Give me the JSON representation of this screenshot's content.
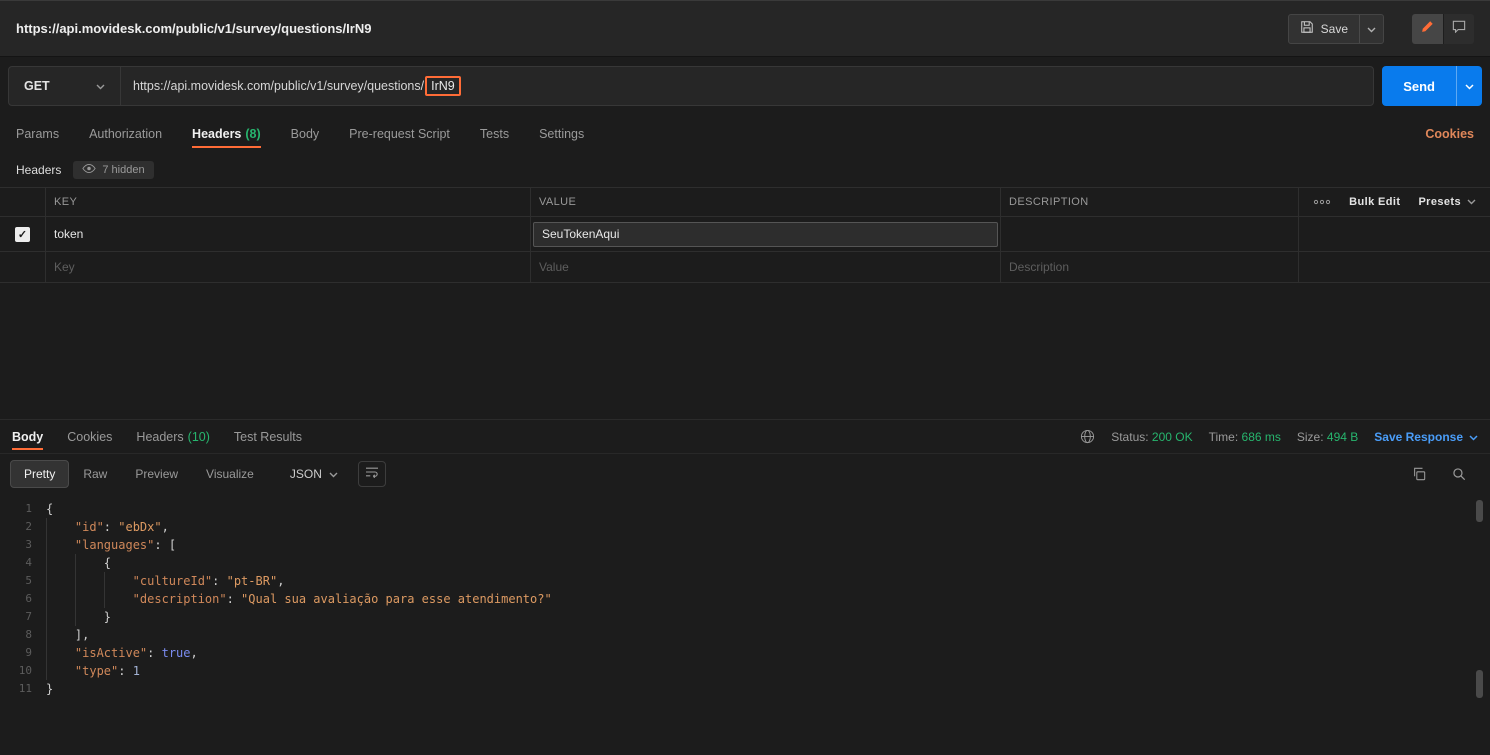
{
  "colors": {
    "accent_orange": "#ff6c37",
    "send_blue": "#097bed",
    "status_green": "#27b56e",
    "link_blue": "#4a9df8"
  },
  "topbar": {
    "request_title": "https://api.movidesk.com/public/v1/survey/questions/IrN9",
    "save_label": "Save"
  },
  "request": {
    "method": "GET",
    "url_prefix": "https://api.movidesk.com/public/v1/survey/questions/",
    "url_highlighted_segment": "IrN9",
    "send_label": "Send",
    "tabs": [
      {
        "label": "Params"
      },
      {
        "label": "Authorization"
      },
      {
        "label": "Headers",
        "count": "(8)",
        "active": true
      },
      {
        "label": "Body"
      },
      {
        "label": "Pre-request Script"
      },
      {
        "label": "Tests"
      },
      {
        "label": "Settings"
      }
    ],
    "cookies_link": "Cookies"
  },
  "headers_editor": {
    "title": "Headers",
    "hidden_badge": "7 hidden",
    "columns": {
      "key": "KEY",
      "value": "VALUE",
      "description": "DESCRIPTION"
    },
    "bulk_edit_label": "Bulk Edit",
    "presets_label": "Presets",
    "rows": [
      {
        "key": "token",
        "value": "SeuTokenAqui",
        "description": ""
      }
    ],
    "placeholders": {
      "key": "Key",
      "value": "Value",
      "description": "Description"
    }
  },
  "response": {
    "tabs": [
      {
        "label": "Body",
        "active": true
      },
      {
        "label": "Cookies"
      },
      {
        "label": "Headers",
        "count": "(10)"
      },
      {
        "label": "Test Results"
      }
    ],
    "meta": {
      "status_label": "Status:",
      "status_value": "200 OK",
      "time_label": "Time:",
      "time_value": "686 ms",
      "size_label": "Size:",
      "size_value": "494 B",
      "save_response_label": "Save Response"
    },
    "view_tabs": [
      {
        "label": "Pretty",
        "active": true
      },
      {
        "label": "Raw"
      },
      {
        "label": "Preview"
      },
      {
        "label": "Visualize"
      }
    ],
    "format_dropdown": "JSON",
    "code": {
      "lines": [
        {
          "n": 1,
          "indent": 0,
          "tokens": [
            {
              "t": "p",
              "v": "{"
            }
          ]
        },
        {
          "n": 2,
          "indent": 1,
          "tokens": [
            {
              "t": "k",
              "v": "\"id\""
            },
            {
              "t": "p",
              "v": ": "
            },
            {
              "t": "s",
              "v": "\"ebDx\""
            },
            {
              "t": "p",
              "v": ","
            }
          ]
        },
        {
          "n": 3,
          "indent": 1,
          "tokens": [
            {
              "t": "k",
              "v": "\"languages\""
            },
            {
              "t": "p",
              "v": ": ["
            }
          ]
        },
        {
          "n": 4,
          "indent": 2,
          "tokens": [
            {
              "t": "p",
              "v": "{"
            }
          ]
        },
        {
          "n": 5,
          "indent": 3,
          "tokens": [
            {
              "t": "k",
              "v": "\"cultureId\""
            },
            {
              "t": "p",
              "v": ": "
            },
            {
              "t": "s",
              "v": "\"pt-BR\""
            },
            {
              "t": "p",
              "v": ","
            }
          ]
        },
        {
          "n": 6,
          "indent": 3,
          "tokens": [
            {
              "t": "k",
              "v": "\"description\""
            },
            {
              "t": "p",
              "v": ": "
            },
            {
              "t": "s",
              "v": "\"Qual sua avaliação para esse atendimento?\""
            }
          ]
        },
        {
          "n": 7,
          "indent": 2,
          "tokens": [
            {
              "t": "p",
              "v": "}"
            }
          ]
        },
        {
          "n": 8,
          "indent": 1,
          "tokens": [
            {
              "t": "p",
              "v": "],"
            }
          ]
        },
        {
          "n": 9,
          "indent": 1,
          "tokens": [
            {
              "t": "k",
              "v": "\"isActive\""
            },
            {
              "t": "p",
              "v": ": "
            },
            {
              "t": "b",
              "v": "true"
            },
            {
              "t": "p",
              "v": ","
            }
          ]
        },
        {
          "n": 10,
          "indent": 1,
          "tokens": [
            {
              "t": "k",
              "v": "\"type\""
            },
            {
              "t": "p",
              "v": ": "
            },
            {
              "t": "n",
              "v": "1"
            }
          ]
        },
        {
          "n": 11,
          "indent": 0,
          "tokens": [
            {
              "t": "p",
              "v": "}"
            }
          ]
        }
      ]
    }
  }
}
